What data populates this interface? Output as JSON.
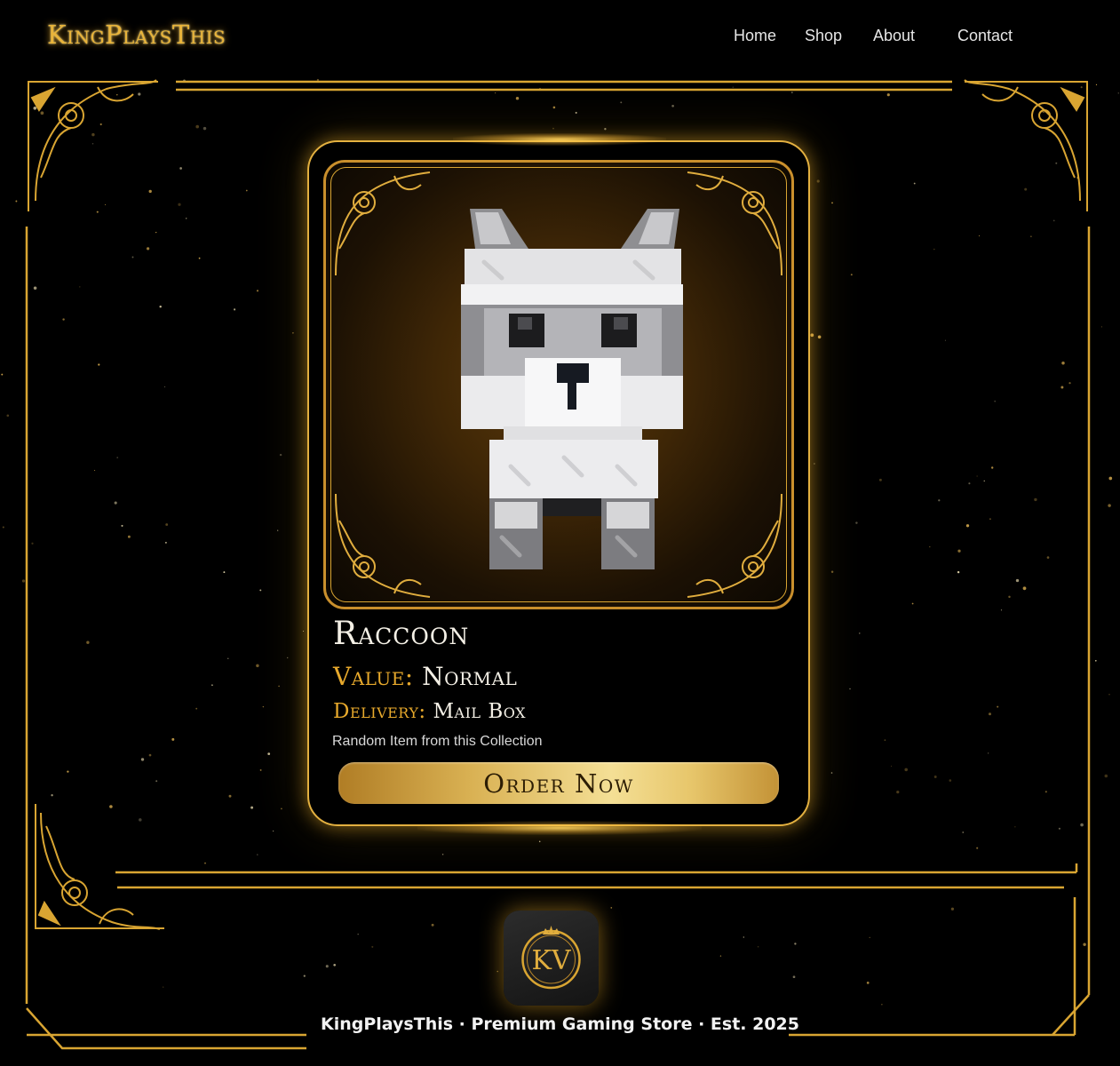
{
  "header": {
    "brand": "KingPlaysThis",
    "nav": [
      {
        "label": "Home"
      },
      {
        "label": "Shop"
      },
      {
        "label": "About"
      },
      {
        "label": "Contact"
      }
    ]
  },
  "product": {
    "name": "Raccoon",
    "value_label": "Value:",
    "value": "Normal",
    "delivery_label": "Delivery:",
    "delivery": "Mail Box",
    "note": "Random Item from this Collection",
    "order_label": "Order Now",
    "image_icon": "blocky-raccoon-pet"
  },
  "footer": {
    "logo_text": "KV",
    "logo_icon": "crown-icon",
    "tagline": "KingPlaysThis · Premium Gaming Store · Est. 2025"
  },
  "theme": {
    "gold": "#d9a532",
    "background": "#000000",
    "accent_text": "#e7a92c"
  }
}
